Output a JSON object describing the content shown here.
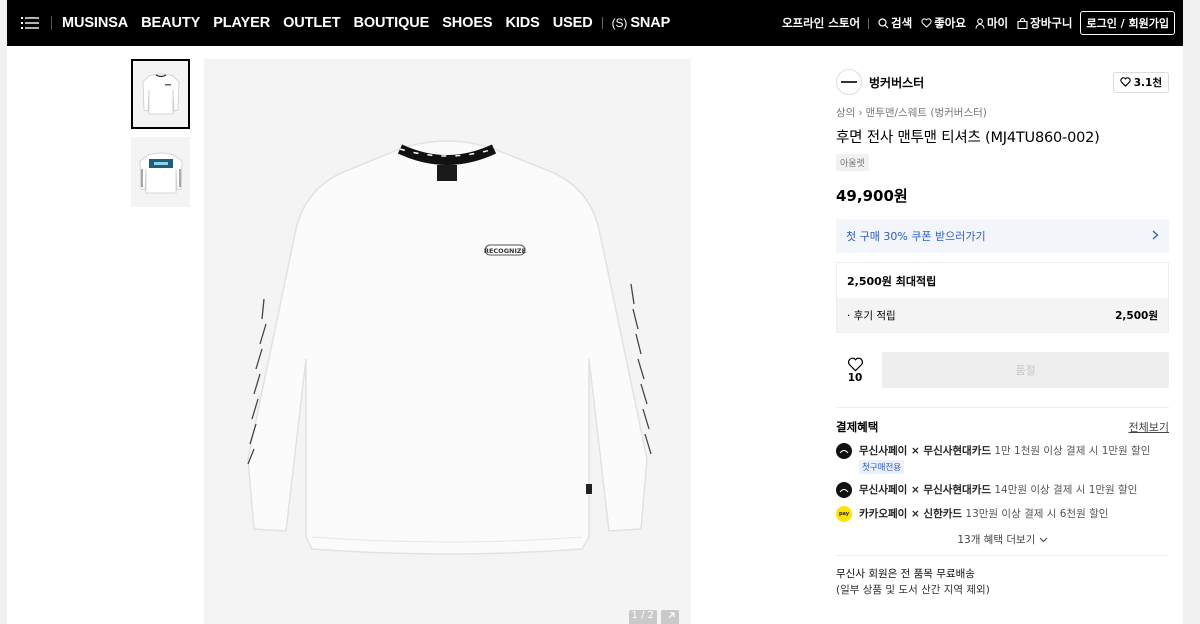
{
  "nav": {
    "items": [
      "MUSINSA",
      "BEAUTY",
      "PLAYER",
      "OUTLET",
      "BOUTIQUE",
      "SHOES",
      "KIDS",
      "USED"
    ],
    "snap": "SNAP",
    "snap_prefix": "(S)",
    "offline_store": "오프라인 스토어",
    "search": "검색",
    "likes": "좋아요",
    "my": "마이",
    "cart": "장바구니",
    "login": "로그인 / 회원가입"
  },
  "gallery": {
    "counter": "1 / 2",
    "print_text": "RECOGNIZE",
    "thumb_count": 2
  },
  "product": {
    "brand": "벙커버스터",
    "like_count": "3.1천",
    "breadcrumb": [
      "상의",
      "맨투맨/스웨트 (벙커버스터)"
    ],
    "title": "후면 전사 맨투맨 티셔츠 (MJ4TU860-002)",
    "tag": "아울렛",
    "price": "49,900원",
    "coupon_text": "첫 구매 30% 쿠폰 받으러가기",
    "points_max": "2,500원 최대적립",
    "review_points_label": "· 후기 적립",
    "review_points_value": "2,500원",
    "wish_count": "10",
    "buy_button": "품절"
  },
  "benefits": {
    "heading": "결제혜택",
    "view_all": "전체보기",
    "items": [
      {
        "card": "무신사페이 × 무신사현대카드",
        "desc": "1만 1천원 이상 결제 시 1만원 할인",
        "badge": "첫구매전용",
        "color": "#111111"
      },
      {
        "card": "무신사페이 × 무신사현대카드",
        "desc": "14만원 이상 결제 시 1만원 할인",
        "badge": "",
        "color": "#111111"
      },
      {
        "card": "카카오페이 × 신한카드",
        "desc": "13만원 이상 결제 시 6천원 할인",
        "badge": "",
        "color": "#ffe300"
      }
    ],
    "more": "13개 혜택 더보기"
  },
  "shipping": {
    "line1": "무신사 회원은 전 품목 무료배송",
    "line2": "(일부 상품 및 도서 산간 지역 제외)"
  },
  "colors": {
    "topbar": "#000000",
    "accent_blue": "#2a5ccf"
  }
}
